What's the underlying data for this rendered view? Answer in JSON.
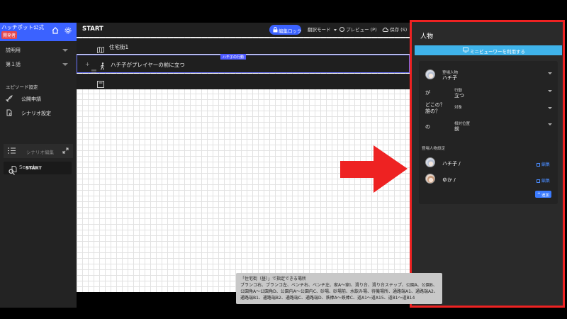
{
  "sidebar": {
    "brand_title": "ハッチポット公式",
    "brand_badge": "開発者",
    "select1": "説明用",
    "select2": "第１話",
    "section_label": "エピソード設定",
    "item_publish": "公開申請",
    "item_scenario_settings": "シナリオ設定",
    "item_scenario_edit": "シナリオ編集",
    "search_placeholder": "Search",
    "scene_item": "START"
  },
  "header": {
    "title": "START",
    "lock_label": "編集ロック",
    "translate_label": "翻訳モード",
    "preview_label": "プレビュー (P)",
    "save_label": "保存 (S)"
  },
  "editor": {
    "row1": "住宅街1",
    "row2": "ハチ子がプレイヤーの前に立つ",
    "row2_tag": "ハチ子の行動"
  },
  "panel": {
    "title": "人物",
    "mini_viewer_button": "ミニビューワーを利用する",
    "character_label": "登場人物",
    "character_value": "ハチ子",
    "particle_ga": "が",
    "action_label": "行動",
    "action_value": "立つ",
    "question": "どこの？\n誰の？",
    "target_label": "対象",
    "particle_no": "の",
    "relpos_label": "相対位置",
    "relpos_value": "前",
    "settings_title": "登場人物設定",
    "chars": [
      {
        "name": "ハチ子 /",
        "edit": "編集"
      },
      {
        "name": "ゆか /",
        "edit": "編集"
      }
    ],
    "add_label": "追加"
  },
  "tooltip": {
    "title": "「住宅街（昼）」で指定できる場所",
    "body": "ブランコ右、ブランコ左、ベンチ右、ベンチ左、家A〜家I、滑り台、滑り台ステップ、公園A、公園B、公園角A〜公園角D、公園内A〜公園内C、砂場、砂場前、水飲み場、待機場所、通路端A1、通路端A2、通路端B1、通路端B2、通路端C、通路端D、鉄棒A〜鉄棒C、道A1〜道A15、道B1〜道B14"
  },
  "colors": {
    "accent_blue": "#3b62ff",
    "highlight_red": "#ee2222",
    "mini_viewer_cyan": "#3fb3ea"
  }
}
